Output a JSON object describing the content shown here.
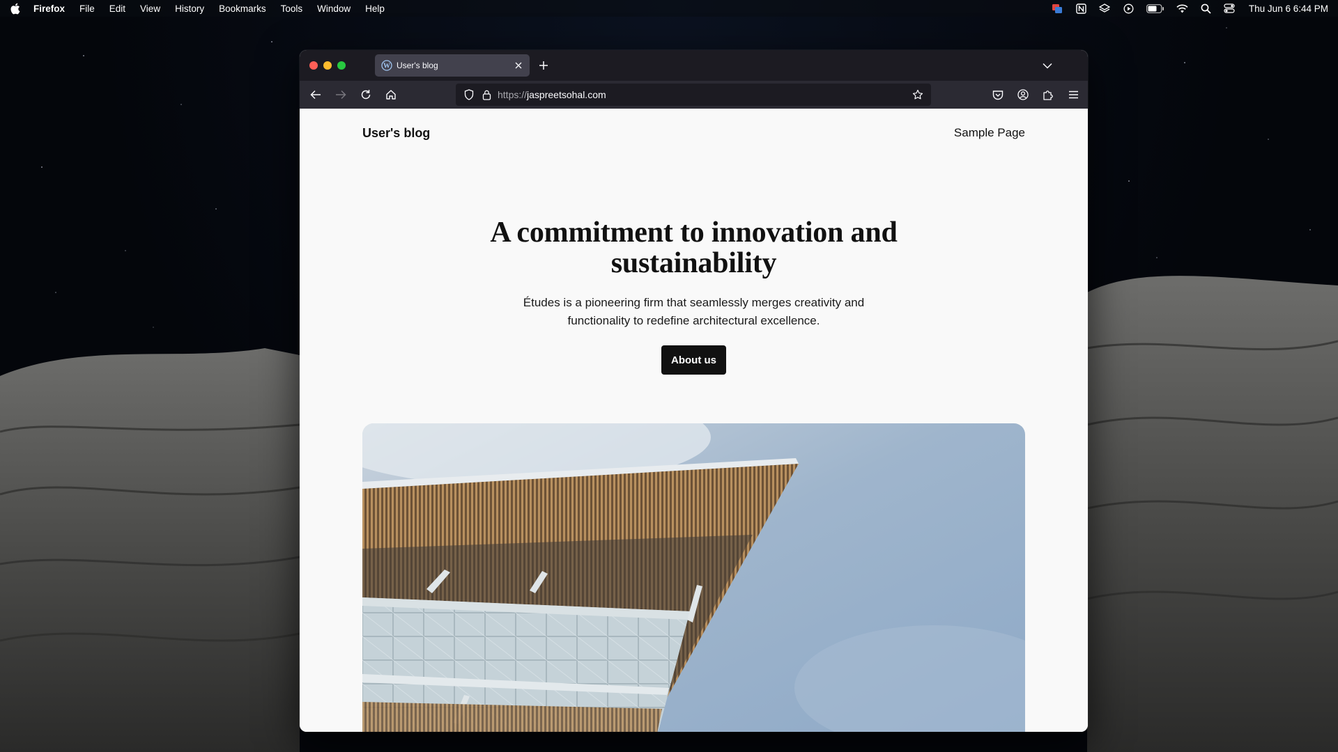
{
  "menubar": {
    "app_name": "Firefox",
    "items": [
      "File",
      "Edit",
      "View",
      "History",
      "Bookmarks",
      "Tools",
      "Window",
      "Help"
    ],
    "clock": "Thu Jun 6  6:44 PM"
  },
  "browser": {
    "tab": {
      "title": "User's blog"
    },
    "url": {
      "scheme": "https://",
      "host": "jaspreetsohal.com"
    }
  },
  "site": {
    "title": "User's blog",
    "nav_link": "Sample Page",
    "hero": {
      "heading_line1": "A commitment to innovation and",
      "heading_line2": "sustainability",
      "sub_line1": "Études is a pioneering firm that seamlessly merges creativity and",
      "sub_line2": "functionality to redefine architectural excellence.",
      "button": "About us"
    }
  }
}
